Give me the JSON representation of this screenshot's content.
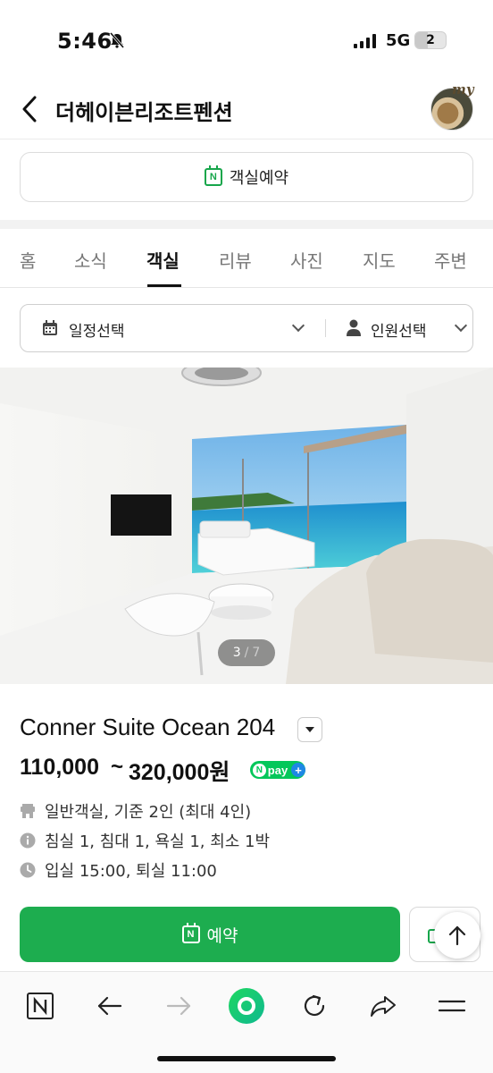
{
  "status_bar": {
    "time": "5:46",
    "network": "5G",
    "battery_level": "2"
  },
  "header": {
    "title": "더헤이븐리조트펜션",
    "avatar_text": "my"
  },
  "reserve_button": {
    "label": "객실예약",
    "icon": "n-calendar-icon"
  },
  "tabs": [
    {
      "label": "홈"
    },
    {
      "label": "소식"
    },
    {
      "label": "객실"
    },
    {
      "label": "리뷰"
    },
    {
      "label": "사진"
    },
    {
      "label": "지도"
    },
    {
      "label": "주변"
    }
  ],
  "active_tab": "객실",
  "selector": {
    "date_label": "일정선택",
    "people_label": "인원선택"
  },
  "photo": {
    "current": "3",
    "separator": "/",
    "total": "7"
  },
  "room": {
    "name": "Conner Suite Ocean 204",
    "price_min": "110,000",
    "tilde": "~",
    "price_max": "320,000원",
    "npay_label": "pay",
    "info": [
      {
        "icon": "room-type-icon",
        "text": "일반객실, 기준 2인 (최대 4인)"
      },
      {
        "icon": "info-icon",
        "text": "침실 1, 침대 1, 욕실 1, 최소 1박"
      },
      {
        "icon": "clock-icon",
        "text": "입실 15:00, 퇴실 11:00"
      }
    ]
  },
  "book_button": {
    "label": "예약"
  },
  "toolbar": {
    "items": [
      "naver-n-icon",
      "back-arrow-icon",
      "forward-arrow-icon",
      "home-circle-icon",
      "refresh-icon",
      "share-icon",
      "menu-icon"
    ]
  },
  "colors": {
    "brand_green": "#1dad4f",
    "npay_green": "#03c75a",
    "npay_blue": "#1e88e5"
  }
}
